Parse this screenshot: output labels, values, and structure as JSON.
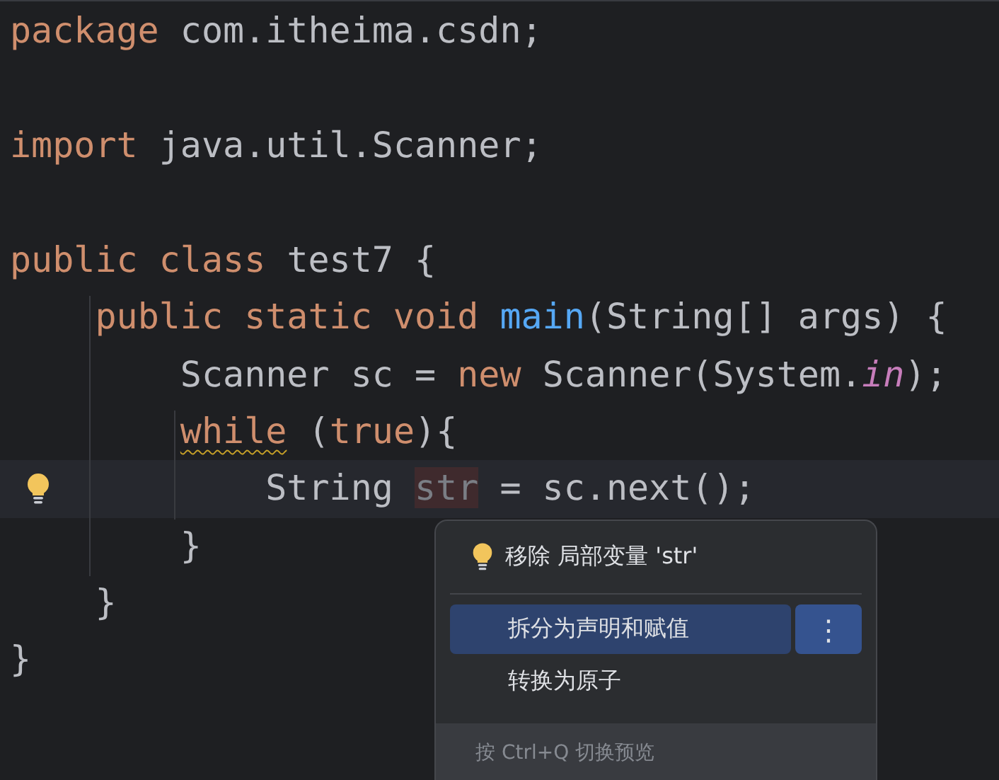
{
  "editor": {
    "lines": [
      {
        "current": false,
        "tokens": [
          {
            "kind": "keyword",
            "text": "package"
          },
          {
            "kind": "plain",
            "text": " com.itheima.csdn;"
          }
        ]
      },
      {
        "current": false
      },
      {
        "current": false,
        "tokens": [
          {
            "kind": "keyword",
            "text": "import"
          },
          {
            "kind": "plain",
            "text": " java.util.Scanner;"
          }
        ]
      },
      {
        "current": false
      },
      {
        "current": false,
        "tokens": [
          {
            "kind": "keyword",
            "text": "public class"
          },
          {
            "kind": "plain",
            "text": " test7 {"
          }
        ]
      },
      {
        "current": false,
        "tokens": [
          {
            "kind": "keyword",
            "text": "    public static void "
          },
          {
            "kind": "method",
            "text": "main"
          },
          {
            "kind": "plain",
            "text": "(String[] args) {"
          }
        ]
      },
      {
        "current": false,
        "tokens": [
          {
            "kind": "plain",
            "text": "        Scanner sc = "
          },
          {
            "kind": "keyword",
            "text": "new"
          },
          {
            "kind": "plain",
            "text": " Scanner(System."
          },
          {
            "kind": "static",
            "text": "in"
          },
          {
            "kind": "plain",
            "text": ");"
          }
        ]
      },
      {
        "current": false,
        "tokens": [
          {
            "kind": "warning",
            "text": "        while"
          },
          {
            "kind": "plain",
            "text": " ("
          },
          {
            "kind": "keyword",
            "text": "true"
          },
          {
            "kind": "plain",
            "text": "){"
          }
        ]
      },
      {
        "current": true,
        "tokens": [
          {
            "kind": "plain",
            "text": "            String "
          },
          {
            "kind": "unused",
            "text": "str"
          },
          {
            "kind": "plain",
            "text": " = sc.next();"
          }
        ]
      },
      {
        "current": false,
        "tokens": [
          {
            "kind": "plain",
            "text": "        }"
          }
        ]
      },
      {
        "current": false,
        "tokens": [
          {
            "kind": "plain",
            "text": "    }"
          }
        ]
      },
      {
        "current": false,
        "tokens": [
          {
            "kind": "plain",
            "text": "}"
          }
        ]
      }
    ]
  },
  "intention_popup": {
    "header": "移除 局部变量 'str'",
    "items": [
      {
        "label": "拆分为声明和赋值",
        "selected": true,
        "more": "⋮"
      },
      {
        "label": "转换为原子",
        "selected": false
      }
    ],
    "footer": "按 Ctrl+Q 切换预览"
  }
}
